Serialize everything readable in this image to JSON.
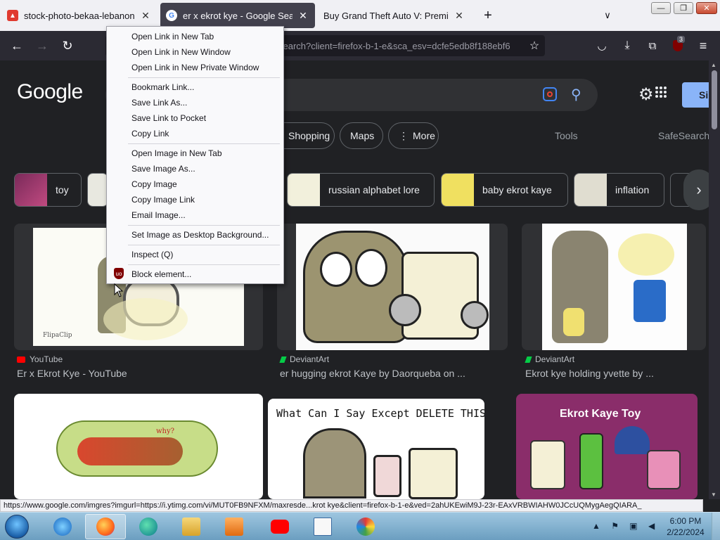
{
  "browser": {
    "tabs": [
      {
        "title": "stock-photo-bekaa-lebanon-se",
        "active": false,
        "favicon_color": "#e03a2f"
      },
      {
        "title": "er x ekrot kye - Google Search",
        "active": true,
        "favicon_color": "#ffffff"
      },
      {
        "title": "Buy Grand Theft Auto V: Premium C",
        "active": false,
        "favicon_color": ""
      }
    ],
    "new_tab_icon": "+",
    "tab_list_icon": "chevron-down-icon",
    "window_controls": {
      "minimize": "—",
      "maximize": "❐",
      "close": "✕"
    },
    "url_text": "search?client=firefox-b-1-e&sca_esv=dcfe5edb8f188ebf6",
    "extension_badge": "3",
    "status_url": "https://www.google.com/imgres?imgurl=https://i.ytimg.com/vi/MUT0FB9NFXM/maxresde...krot kye&client=firefox-b-1-e&ved=2ahUKEwiM9J-23r-EAxVRBWIAHW0JCcUQMygAegQIARA_"
  },
  "google": {
    "logo": "Google",
    "sign_in_label": "Si",
    "filters": [
      "Shopping",
      "Maps",
      "More"
    ],
    "tools_label": "Tools",
    "safesearch_label": "SafeSearch",
    "chips": [
      {
        "label": "toy"
      },
      {
        "label": ""
      },
      {
        "label": "russian alphabet lore"
      },
      {
        "label": "baby ekrot kaye"
      },
      {
        "label": "inflation"
      },
      {
        "label": ""
      }
    ],
    "results": [
      {
        "source": "YouTube",
        "title": "Er x Ekrot Kye - YouTube",
        "source_icon": "youtube-icon"
      },
      {
        "source": "DeviantArt",
        "title": "er hugging ekrot Kaye by Daorqueba on ...",
        "source_icon": "deviantart-icon"
      },
      {
        "source": "DeviantArt",
        "title": "Ekrot kye holding yvette by ...",
        "source_icon": "deviantart-icon"
      }
    ],
    "second_row": {
      "caption_text": "What Can I Say Except DELETE THIS!",
      "toy_title": "Ekrot Kaye Toy",
      "drawing_text": "why?",
      "watermark": "FlipaClip"
    }
  },
  "context_menu": {
    "items": [
      "Open Link in New Tab",
      "Open Link in New Window",
      "Open Link in New Private Window",
      "Bookmark Link...",
      "Save Link As...",
      "Save Link to Pocket",
      "Copy Link",
      "Open Image in New Tab",
      "Save Image As...",
      "Copy Image",
      "Copy Image Link",
      "Email Image...",
      "Set Image as Desktop Background...",
      "Inspect (Q)",
      "Block element..."
    ]
  },
  "taskbar": {
    "time": "6:00 PM",
    "date": "2/22/2024",
    "apps": [
      "internet-explorer-icon",
      "firefox-icon",
      "edge-icon",
      "file-explorer-icon",
      "media-player-icon",
      "youtube-icon",
      "task-manager-icon",
      "paint-icon"
    ]
  }
}
